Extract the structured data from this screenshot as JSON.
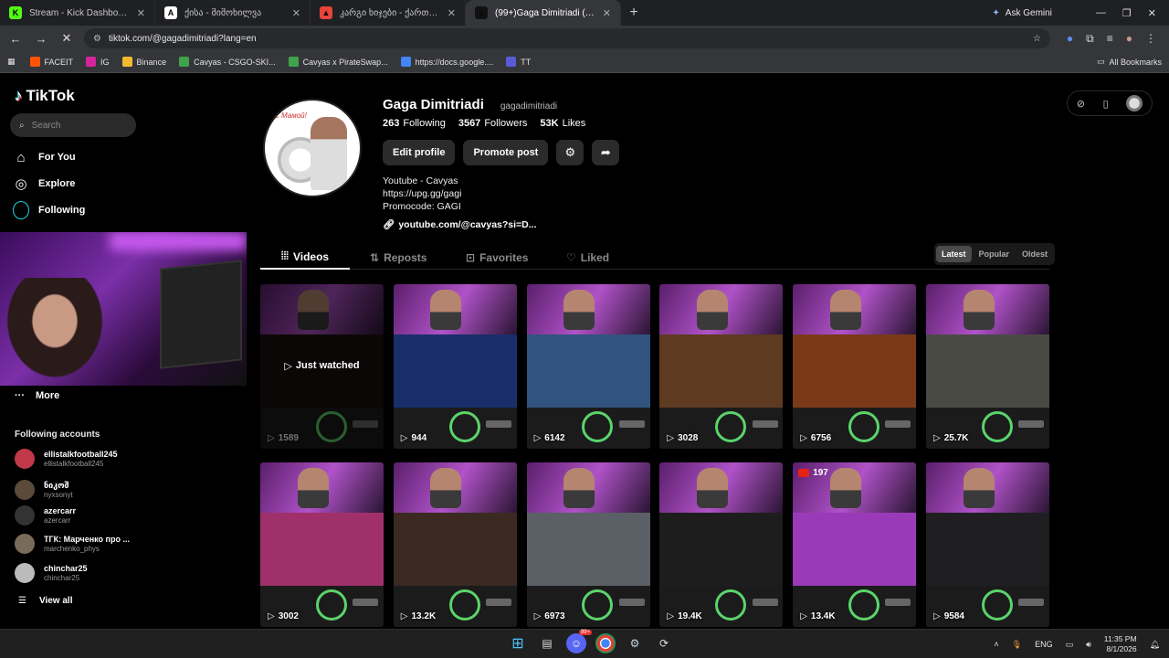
{
  "browser": {
    "tabs": [
      {
        "title": "Stream - Kick Dashboard",
        "favicon": "K",
        "color": "#53fc18",
        "active": false
      },
      {
        "title": "ქისა - მიმოხილვა",
        "favicon": "A",
        "color": "#ffffff",
        "active": false
      },
      {
        "title": "კარგი ხიჯები - ქართულად",
        "favicon": "▲",
        "color": "#e8443a",
        "active": false
      },
      {
        "title": "(99+)Gaga Dimitriadi (@gagadimitriadi)",
        "favicon": "♪",
        "color": "#111111",
        "active": true
      }
    ],
    "ask_gemini": "Ask Gemini",
    "url": "tiktok.com/@gagadimitriadi?lang=en",
    "bookmarks": [
      {
        "label": "FACEIT",
        "color": "#ff5500"
      },
      {
        "label": "IG",
        "color": "#d6249f"
      },
      {
        "label": "Binance",
        "color": "#f3ba2f"
      },
      {
        "label": "Cavyas - CSGO-SKI...",
        "color": "#3fa34d"
      },
      {
        "label": "Cavyas x PirateSwap...",
        "color": "#3fa34d"
      },
      {
        "label": "https://docs.google....",
        "color": "#4285f4"
      },
      {
        "label": "TT",
        "color": "#5b5bd6"
      }
    ],
    "all_bookmarks": "All Bookmarks"
  },
  "sidebar": {
    "logo": "TikTok",
    "search_placeholder": "Search",
    "nav": [
      {
        "label": "For You",
        "icon": "home-icon"
      },
      {
        "label": "Explore",
        "icon": "compass-icon"
      },
      {
        "label": "Following",
        "icon": "following-icon"
      }
    ],
    "more": "More",
    "following_title": "Following accounts",
    "accounts": [
      {
        "name": "ellistalkfootball245",
        "handle": "ellistalkfootball245",
        "color": "#c0394a"
      },
      {
        "name": "ნიკოშ",
        "handle": "nyxsonyt",
        "color": "#5a4a3a"
      },
      {
        "name": "azercarr",
        "handle": "azercarr",
        "color": "#333333"
      },
      {
        "name": "ТГК: Марченко про ...",
        "handle": "marchenko_phys",
        "color": "#7a6a5a"
      },
      {
        "name": "chinchar25",
        "handle": "chinchar25",
        "color": "#bbbbbb"
      }
    ],
    "view_all": "View all"
  },
  "profile": {
    "name": "Gaga Dimitriadi",
    "handle": "gagadimitriadi",
    "following_count": "263",
    "following_label": "Following",
    "followers_count": "3567",
    "followers_label": "Followers",
    "likes_count": "53K",
    "likes_label": "Likes",
    "edit_profile": "Edit profile",
    "promote_post": "Promote post",
    "bio_lines": [
      "Youtube - Cavyas",
      "https://upg.gg/gagi",
      "Promocode: GAGI"
    ],
    "link": "youtube.com/@cavyas?si=D...",
    "avatar_caption": "C Мамой!"
  },
  "tabs": [
    {
      "label": "Videos",
      "active": true
    },
    {
      "label": "Reposts",
      "active": false
    },
    {
      "label": "Favorites",
      "active": false
    },
    {
      "label": "Liked",
      "active": false
    }
  ],
  "sort": [
    "Latest",
    "Popular",
    "Oldest"
  ],
  "just_watched": "Just watched",
  "videos": [
    {
      "views": "1589",
      "mid": "#1a1010",
      "watched": true
    },
    {
      "views": "944",
      "mid": "#1a2e6b",
      "watched": false
    },
    {
      "views": "6142",
      "mid": "#30547e",
      "watched": false
    },
    {
      "views": "3028",
      "mid": "#5e3a20",
      "watched": false
    },
    {
      "views": "6756",
      "mid": "#7a3a1a",
      "watched": false
    },
    {
      "views": "25.7K",
      "mid": "#4a4a44",
      "watched": false
    },
    {
      "views": "3002",
      "mid": "#a0306a",
      "watched": false
    },
    {
      "views": "13.2K",
      "mid": "#3a2a22",
      "watched": false
    },
    {
      "views": "6973",
      "mid": "#5a6066",
      "watched": false
    },
    {
      "views": "19.4K",
      "mid": "#1d1d1d",
      "watched": false
    },
    {
      "views": "13.4K",
      "mid": "#9a3ab8",
      "watched": false,
      "live": "197"
    },
    {
      "views": "9584",
      "mid": "#1f1f22",
      "watched": false
    }
  ],
  "taskbar": {
    "lang": "ENG",
    "time": "11:35 PM",
    "date": "8/1/2026",
    "discord_badge": "99+"
  }
}
